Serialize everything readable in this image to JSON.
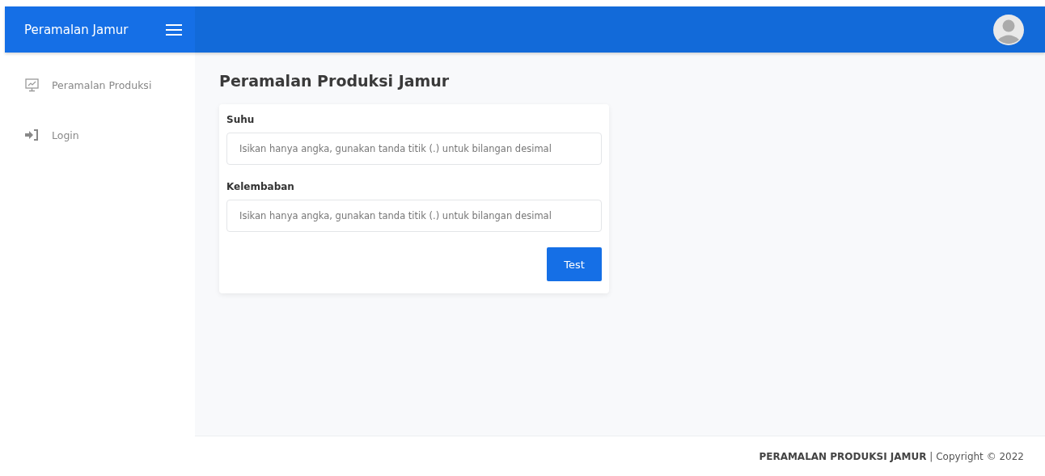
{
  "brand": {
    "title": "Peramalan Jamur"
  },
  "sidebar": {
    "items": [
      {
        "label": "Peramalan Produksi",
        "kind": "chart"
      },
      {
        "label": "Login",
        "kind": "login"
      }
    ]
  },
  "page": {
    "title": "Peramalan Produksi Jamur"
  },
  "form": {
    "fields": [
      {
        "label": "Suhu",
        "placeholder": "Isikan hanya angka, gunakan tanda titik (.) untuk bilangan desimal"
      },
      {
        "label": "Kelembaban",
        "placeholder": "Isikan hanya angka, gunakan tanda titik (.) untuk bilangan desimal"
      }
    ],
    "button": "Test"
  },
  "footer": {
    "text": "**PERAMALAN PRODUKSI JAMUR** | Copyright © 2022"
  }
}
